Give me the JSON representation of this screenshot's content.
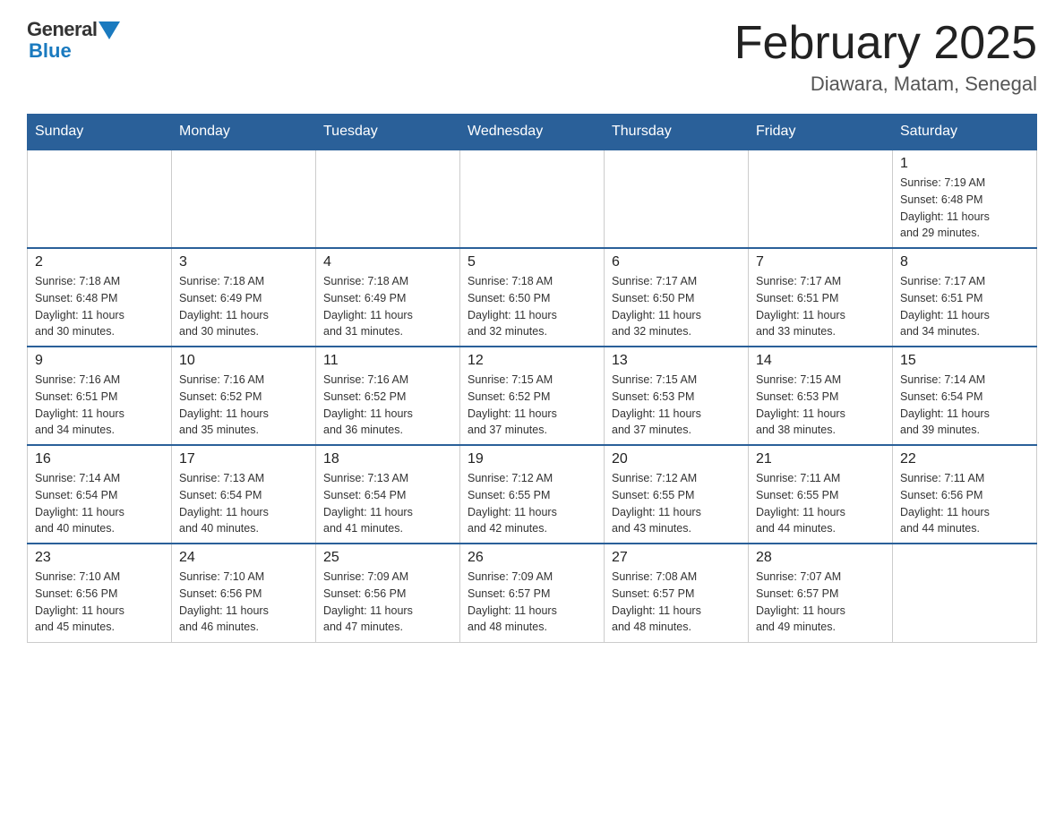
{
  "logo": {
    "general": "General",
    "blue": "Blue"
  },
  "title": "February 2025",
  "location": "Diawara, Matam, Senegal",
  "weekdays": [
    "Sunday",
    "Monday",
    "Tuesday",
    "Wednesday",
    "Thursday",
    "Friday",
    "Saturday"
  ],
  "weeks": [
    [
      {
        "day": "",
        "info": ""
      },
      {
        "day": "",
        "info": ""
      },
      {
        "day": "",
        "info": ""
      },
      {
        "day": "",
        "info": ""
      },
      {
        "day": "",
        "info": ""
      },
      {
        "day": "",
        "info": ""
      },
      {
        "day": "1",
        "info": "Sunrise: 7:19 AM\nSunset: 6:48 PM\nDaylight: 11 hours\nand 29 minutes."
      }
    ],
    [
      {
        "day": "2",
        "info": "Sunrise: 7:18 AM\nSunset: 6:48 PM\nDaylight: 11 hours\nand 30 minutes."
      },
      {
        "day": "3",
        "info": "Sunrise: 7:18 AM\nSunset: 6:49 PM\nDaylight: 11 hours\nand 30 minutes."
      },
      {
        "day": "4",
        "info": "Sunrise: 7:18 AM\nSunset: 6:49 PM\nDaylight: 11 hours\nand 31 minutes."
      },
      {
        "day": "5",
        "info": "Sunrise: 7:18 AM\nSunset: 6:50 PM\nDaylight: 11 hours\nand 32 minutes."
      },
      {
        "day": "6",
        "info": "Sunrise: 7:17 AM\nSunset: 6:50 PM\nDaylight: 11 hours\nand 32 minutes."
      },
      {
        "day": "7",
        "info": "Sunrise: 7:17 AM\nSunset: 6:51 PM\nDaylight: 11 hours\nand 33 minutes."
      },
      {
        "day": "8",
        "info": "Sunrise: 7:17 AM\nSunset: 6:51 PM\nDaylight: 11 hours\nand 34 minutes."
      }
    ],
    [
      {
        "day": "9",
        "info": "Sunrise: 7:16 AM\nSunset: 6:51 PM\nDaylight: 11 hours\nand 34 minutes."
      },
      {
        "day": "10",
        "info": "Sunrise: 7:16 AM\nSunset: 6:52 PM\nDaylight: 11 hours\nand 35 minutes."
      },
      {
        "day": "11",
        "info": "Sunrise: 7:16 AM\nSunset: 6:52 PM\nDaylight: 11 hours\nand 36 minutes."
      },
      {
        "day": "12",
        "info": "Sunrise: 7:15 AM\nSunset: 6:52 PM\nDaylight: 11 hours\nand 37 minutes."
      },
      {
        "day": "13",
        "info": "Sunrise: 7:15 AM\nSunset: 6:53 PM\nDaylight: 11 hours\nand 37 minutes."
      },
      {
        "day": "14",
        "info": "Sunrise: 7:15 AM\nSunset: 6:53 PM\nDaylight: 11 hours\nand 38 minutes."
      },
      {
        "day": "15",
        "info": "Sunrise: 7:14 AM\nSunset: 6:54 PM\nDaylight: 11 hours\nand 39 minutes."
      }
    ],
    [
      {
        "day": "16",
        "info": "Sunrise: 7:14 AM\nSunset: 6:54 PM\nDaylight: 11 hours\nand 40 minutes."
      },
      {
        "day": "17",
        "info": "Sunrise: 7:13 AM\nSunset: 6:54 PM\nDaylight: 11 hours\nand 40 minutes."
      },
      {
        "day": "18",
        "info": "Sunrise: 7:13 AM\nSunset: 6:54 PM\nDaylight: 11 hours\nand 41 minutes."
      },
      {
        "day": "19",
        "info": "Sunrise: 7:12 AM\nSunset: 6:55 PM\nDaylight: 11 hours\nand 42 minutes."
      },
      {
        "day": "20",
        "info": "Sunrise: 7:12 AM\nSunset: 6:55 PM\nDaylight: 11 hours\nand 43 minutes."
      },
      {
        "day": "21",
        "info": "Sunrise: 7:11 AM\nSunset: 6:55 PM\nDaylight: 11 hours\nand 44 minutes."
      },
      {
        "day": "22",
        "info": "Sunrise: 7:11 AM\nSunset: 6:56 PM\nDaylight: 11 hours\nand 44 minutes."
      }
    ],
    [
      {
        "day": "23",
        "info": "Sunrise: 7:10 AM\nSunset: 6:56 PM\nDaylight: 11 hours\nand 45 minutes."
      },
      {
        "day": "24",
        "info": "Sunrise: 7:10 AM\nSunset: 6:56 PM\nDaylight: 11 hours\nand 46 minutes."
      },
      {
        "day": "25",
        "info": "Sunrise: 7:09 AM\nSunset: 6:56 PM\nDaylight: 11 hours\nand 47 minutes."
      },
      {
        "day": "26",
        "info": "Sunrise: 7:09 AM\nSunset: 6:57 PM\nDaylight: 11 hours\nand 48 minutes."
      },
      {
        "day": "27",
        "info": "Sunrise: 7:08 AM\nSunset: 6:57 PM\nDaylight: 11 hours\nand 48 minutes."
      },
      {
        "day": "28",
        "info": "Sunrise: 7:07 AM\nSunset: 6:57 PM\nDaylight: 11 hours\nand 49 minutes."
      },
      {
        "day": "",
        "info": ""
      }
    ]
  ]
}
